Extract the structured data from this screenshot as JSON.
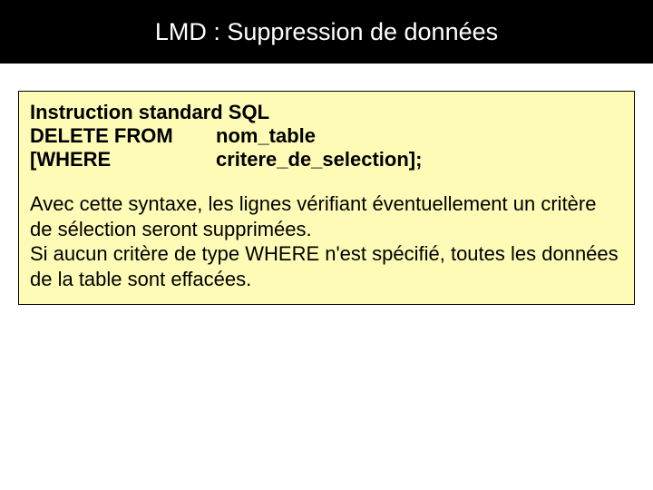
{
  "title": "LMD : Suppression de données",
  "sql": {
    "heading": "Instruction standard SQL",
    "rows": [
      {
        "keyword": "DELETE FROM",
        "value": "nom_table"
      },
      {
        "keyword": "[WHERE",
        "value": "critere_de_selection];"
      }
    ]
  },
  "description": "Avec cette syntaxe, les lignes vérifiant éventuellement un critère de sélection seront supprimées.\nSi aucun critère de type WHERE n'est spécifié, toutes les données de la table sont effacées."
}
